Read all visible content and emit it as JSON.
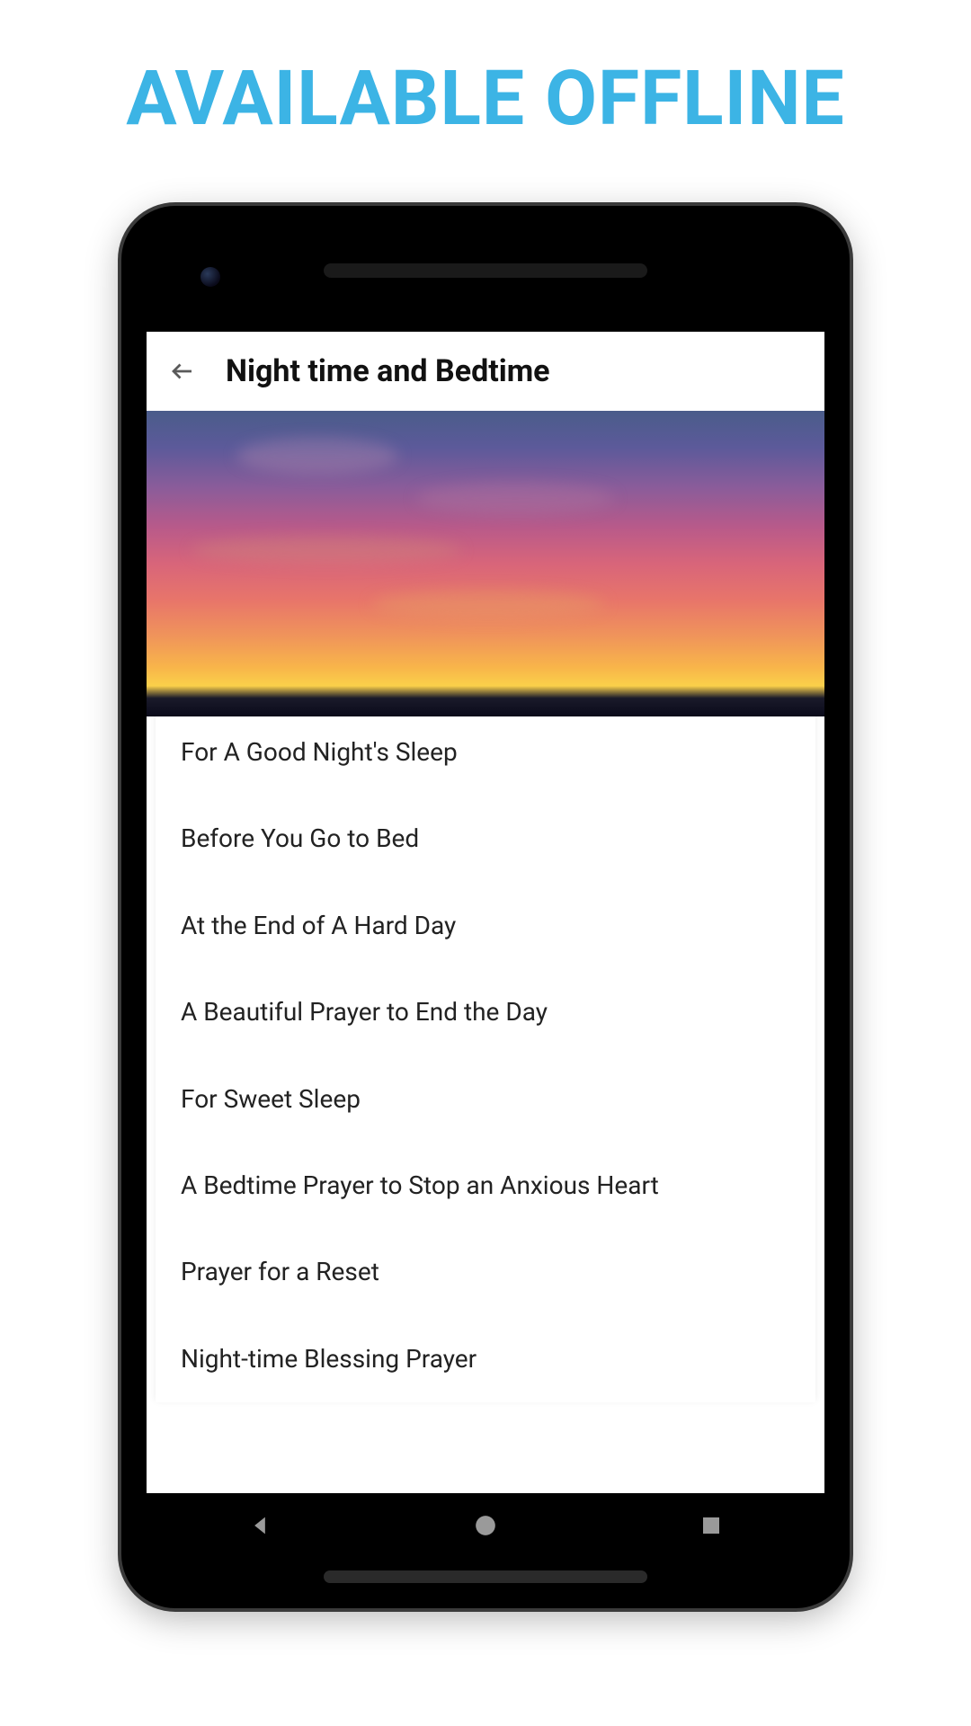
{
  "promo": {
    "headline": "AVAILABLE OFFLINE"
  },
  "appbar": {
    "title": "Night time and Bedtime"
  },
  "prayers": [
    {
      "title": "For A Good Night's Sleep"
    },
    {
      "title": "Before You Go to Bed"
    },
    {
      "title": "At the End of A Hard Day"
    },
    {
      "title": "A Beautiful Prayer to End the Day"
    },
    {
      "title": "For Sweet Sleep"
    },
    {
      "title": "A Bedtime Prayer to Stop an Anxious Heart"
    },
    {
      "title": "Prayer for a Reset"
    },
    {
      "title": "Night-time Blessing Prayer"
    }
  ],
  "nav": {
    "back": "back",
    "home": "home",
    "recent": "recent"
  }
}
